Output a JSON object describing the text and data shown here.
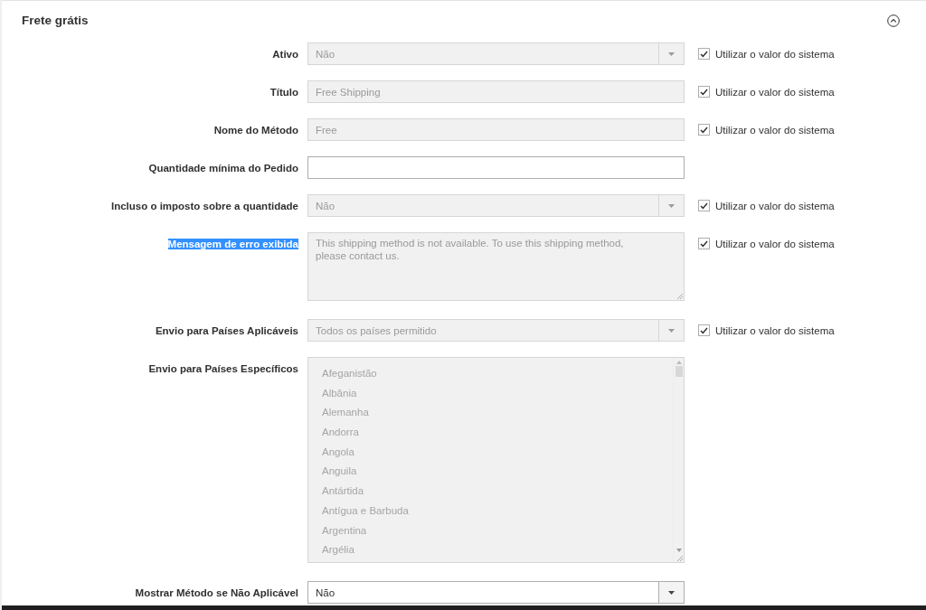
{
  "section": {
    "title": "Frete grátis",
    "expanded": true
  },
  "rows": [
    {
      "kind": "select",
      "label": "Ativo",
      "label_highlighted": false,
      "value": "Não",
      "disabled": true,
      "use_system_value": {
        "label": "Utilizar o valor do sistema",
        "checked": true
      }
    },
    {
      "kind": "text",
      "label": "Título",
      "label_highlighted": false,
      "value": "Free Shipping",
      "disabled": true,
      "use_system_value": {
        "label": "Utilizar o valor do sistema",
        "checked": true
      }
    },
    {
      "kind": "text",
      "label": "Nome do Método",
      "label_highlighted": false,
      "value": "Free",
      "disabled": true,
      "use_system_value": {
        "label": "Utilizar o valor do sistema",
        "checked": true
      }
    },
    {
      "kind": "text",
      "label": "Quantidade mínima do Pedido",
      "label_highlighted": false,
      "disabled": false
    },
    {
      "kind": "select",
      "label": "Incluso o imposto sobre a quantidade",
      "label_highlighted": false,
      "value": "Não",
      "disabled": true,
      "use_system_value": {
        "label": "Utilizar o valor do sistema",
        "checked": true
      }
    },
    {
      "kind": "textarea",
      "label": "Mensagem de erro exibida",
      "label_highlighted": true,
      "value": "This shipping method is not available. To use this shipping method, please contact us.",
      "disabled": true,
      "use_system_value": {
        "label": "Utilizar o valor do sistema",
        "checked": true
      }
    },
    {
      "kind": "select",
      "label": "Envio para Países Aplicáveis",
      "label_highlighted": false,
      "value": "Todos os países permitido",
      "disabled": true,
      "use_system_value": {
        "label": "Utilizar o valor do sistema",
        "checked": true
      }
    },
    {
      "kind": "multiselect",
      "label": "Envio para Países Específicos",
      "label_highlighted": false,
      "disabled": true,
      "options": [
        "Afeganistão",
        "Albânia",
        "Alemanha",
        "Andorra",
        "Angola",
        "Anguila",
        "Antártida",
        "Antígua e Barbuda",
        "Argentina",
        "Argélia"
      ]
    },
    {
      "kind": "select",
      "label": "Mostrar Método se Não Aplicável",
      "label_highlighted": false,
      "value": "Não",
      "disabled": false
    }
  ]
}
